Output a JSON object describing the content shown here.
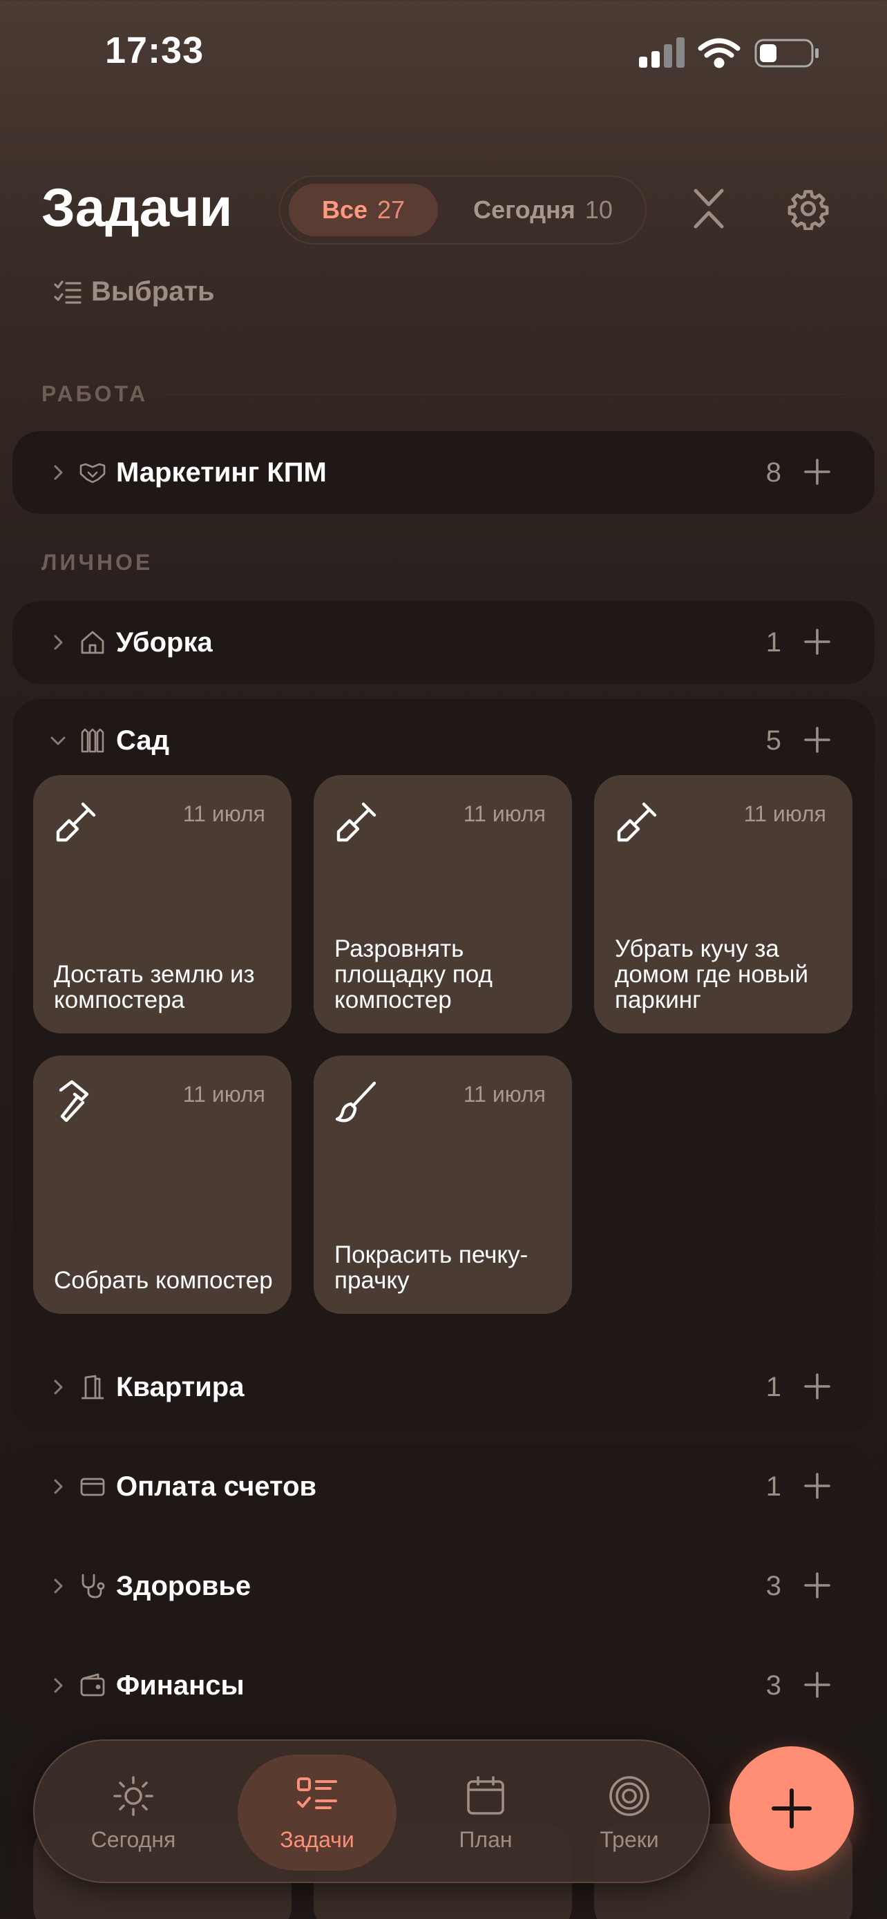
{
  "status_bar": {
    "time": "17:33"
  },
  "header": {
    "title": "Задачи",
    "filter": {
      "all_label": "Все",
      "all_count": "27",
      "today_label": "Сегодня",
      "today_count": "10"
    },
    "select_label": "Выбрать"
  },
  "sections": {
    "work": "РАБОТА",
    "personal": "ЛИЧНОЕ"
  },
  "groups": {
    "marketing": {
      "name": "Маркетинг КПМ",
      "count": "8"
    },
    "cleaning": {
      "name": "Уборка",
      "count": "1"
    },
    "garden": {
      "name": "Сад",
      "count": "5"
    },
    "apartment": {
      "name": "Квартира",
      "count": "1"
    },
    "bills": {
      "name": "Оплата счетов",
      "count": "1"
    },
    "health": {
      "name": "Здоровье",
      "count": "3"
    },
    "finance": {
      "name": "Финансы",
      "count": "3"
    }
  },
  "garden_tasks": [
    {
      "icon": "shovel-icon",
      "date": "11 июля",
      "title": "Достать землю из компостера"
    },
    {
      "icon": "shovel-icon",
      "date": "11 июля",
      "title": "Разровнять площадку под компостер"
    },
    {
      "icon": "shovel-icon",
      "date": "11 июля",
      "title": "Убрать кучу за домом где новый паркинг"
    },
    {
      "icon": "hammer-icon",
      "date": "11 июля",
      "title": "Собрать компостер"
    },
    {
      "icon": "brush-icon",
      "date": "11 июля",
      "title": "Покрасить печку-прачку"
    }
  ],
  "tabbar": {
    "today": "Сегодня",
    "tasks": "Задачи",
    "plan": "План",
    "tracks": "Треки"
  },
  "colors": {
    "accent": "#ff8e74",
    "card": "#4a3b33",
    "group": "#201816"
  }
}
